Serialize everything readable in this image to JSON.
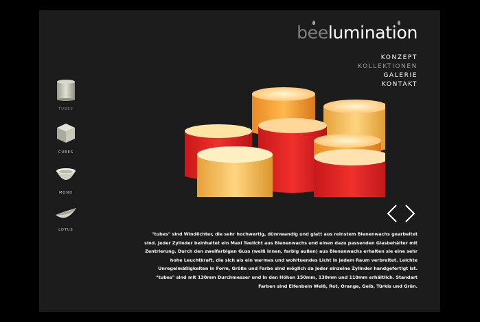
{
  "logo": {
    "part1": "bee",
    "part2": "lumination"
  },
  "nav": [
    {
      "label": "KONZEPT",
      "active": false
    },
    {
      "label": "KOLLEKTIONEN",
      "active": true
    },
    {
      "label": "GALERIE",
      "active": false
    },
    {
      "label": "KONTAKT",
      "active": false
    }
  ],
  "collections": [
    {
      "label": "TUBES",
      "active": true,
      "icon": "tube-icon"
    },
    {
      "label": "CUBES",
      "active": false,
      "icon": "cube-icon"
    },
    {
      "label": "MOND",
      "active": false,
      "icon": "bowl-icon"
    },
    {
      "label": "LOTUS",
      "active": false,
      "icon": "lotus-icon"
    }
  ],
  "description": "\"tubes\" sind Windlichter, die sehr hochwertig, dünnwandig und glatt aus reinstem Bienenwachs gearbeitet sind. Jeder Zylinder beinhaltet ein Maxi Teelicht aus Bienenwachs und einen dazu passenden Glasbehälter mit Zentrierung. Durch den zweifarbigen Guss (weiß innen, farbig außen) aus Bienenwachs erhalten sie eine sehr hohe Leuchtkraft, die sich als ein warmes und wohltuendes Licht in jedem Raum verbreitet. Leichte Unregelmäßigkeiten in Form, Größe und Farbe sind möglich da jeder einzelne Zylinder handgefertigt ist. \"tubes\" sind mit 130mm Durchmesser und in den Höhen 150mm, 130mm und 110mm erhältlich. Standart Farben sind Elfenbein Weiß, Rot, Orange, Gelb, Türkis und Grün.",
  "colors": {
    "background": "#000000",
    "panel": "#1c1c1c",
    "logo_grey": "#7d8379",
    "text": "#ffffff",
    "active": "#9b9b9b"
  }
}
